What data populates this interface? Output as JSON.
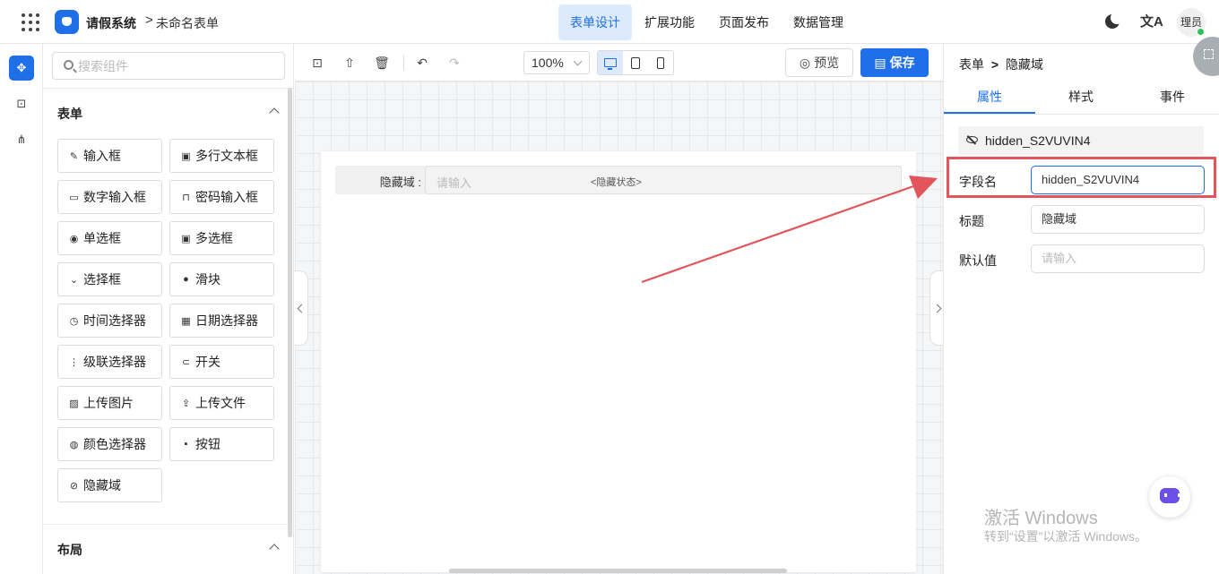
{
  "header": {
    "app_title": "请假系统",
    "crumb_sep": ">",
    "form_name": "未命名表单",
    "tabs": [
      {
        "label": "表单设计",
        "active": true
      },
      {
        "label": "扩展功能",
        "active": false
      },
      {
        "label": "页面发布",
        "active": false
      },
      {
        "label": "数据管理",
        "active": false
      }
    ],
    "translate_glyph": "文A",
    "user_initials": "理员",
    "accent_color": "#1e6fe8"
  },
  "search": {
    "placeholder": "搜索组件",
    "value": ""
  },
  "groups": [
    {
      "title": "表单"
    },
    {
      "title": "布局"
    }
  ],
  "components": [
    {
      "label": "输入框",
      "icon": "pencil-icon",
      "glyph": "✎"
    },
    {
      "label": "多行文本框",
      "icon": "textarea-icon",
      "glyph": "▣"
    },
    {
      "label": "数字输入框",
      "icon": "number-icon",
      "glyph": "▭"
    },
    {
      "label": "密码输入框",
      "icon": "lock-icon",
      "glyph": "🔒"
    },
    {
      "label": "单选框",
      "icon": "radio-icon",
      "glyph": "◉"
    },
    {
      "label": "多选框",
      "icon": "checkbox-icon",
      "glyph": "▣"
    },
    {
      "label": "选择框",
      "icon": "select-icon",
      "glyph": "⌄"
    },
    {
      "label": "滑块",
      "icon": "slider-icon",
      "glyph": "●−"
    },
    {
      "label": "时间选择器",
      "icon": "clock-icon",
      "glyph": "◷"
    },
    {
      "label": "日期选择器",
      "icon": "calendar-icon",
      "glyph": "▦"
    },
    {
      "label": "级联选择器",
      "icon": "cascader-icon",
      "glyph": "⋮≡"
    },
    {
      "label": "开关",
      "icon": "switch-icon",
      "glyph": "⊂●"
    },
    {
      "label": "上传图片",
      "icon": "image-icon",
      "glyph": "▨"
    },
    {
      "label": "上传文件",
      "icon": "upload-icon",
      "glyph": "⇪"
    },
    {
      "label": "颜色选择器",
      "icon": "palette-icon",
      "glyph": "◍"
    },
    {
      "label": "按钮",
      "icon": "button-icon",
      "glyph": "[▪]"
    },
    {
      "label": "隐藏域",
      "icon": "eye-off-icon",
      "glyph": "⊘"
    }
  ],
  "toolbar": {
    "zoom": "100%",
    "preview_label": "预览",
    "save_label": "保存"
  },
  "canvas": {
    "field_label": "隐藏域 :",
    "field_placeholder": "请输入",
    "field_state": "<隐藏状态>"
  },
  "properties": {
    "crumb_parent": "表单",
    "crumb_sep": ">",
    "crumb_current": "隐藏域",
    "tabs": [
      {
        "label": "属性",
        "active": true
      },
      {
        "label": "样式",
        "active": false
      },
      {
        "label": "事件",
        "active": false
      }
    ],
    "component_id": "hidden_S2VUVIN4",
    "fields": [
      {
        "label": "字段名",
        "value": "hidden_S2VUVIN4",
        "placeholder": false
      },
      {
        "label": "标题",
        "value": "隐藏域",
        "placeholder": false
      },
      {
        "label": "默认值",
        "value": "请输入",
        "placeholder": true
      }
    ],
    "highlight_color": "#e2555a"
  },
  "watermark": {
    "line1": "激活 Windows",
    "line2": "转到“设置”以激活 Windows。"
  }
}
